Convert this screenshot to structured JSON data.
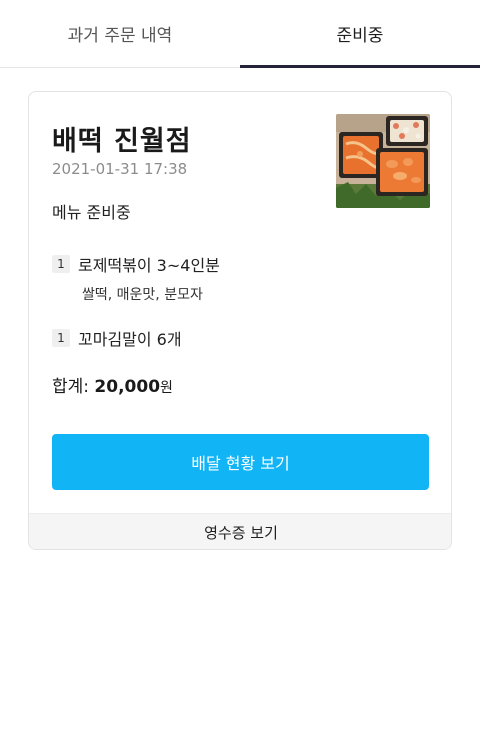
{
  "tabs": [
    {
      "label": "과거 주문 내역",
      "active": false
    },
    {
      "label": "준비중",
      "active": true
    }
  ],
  "order": {
    "store_name": "배떡 진월점",
    "date": "2021-01-31 17:38",
    "status": "메뉴 준비중",
    "thumbnail": "tteokbokki-food-photo",
    "items": [
      {
        "qty": "1",
        "name": "로제떡볶이 3~4인분",
        "options": "쌀떡, 매운맛, 분모자"
      },
      {
        "qty": "1",
        "name": "꼬마김말이 6개",
        "options": ""
      }
    ],
    "total_label": "합계:",
    "total_amount": "20,000",
    "total_unit": "원"
  },
  "buttons": {
    "delivery_status": "배달 현황 보기",
    "receipt": "영수증 보기"
  },
  "colors": {
    "primary_button": "#11b4f5",
    "active_tab_indicator": "#23233a"
  }
}
